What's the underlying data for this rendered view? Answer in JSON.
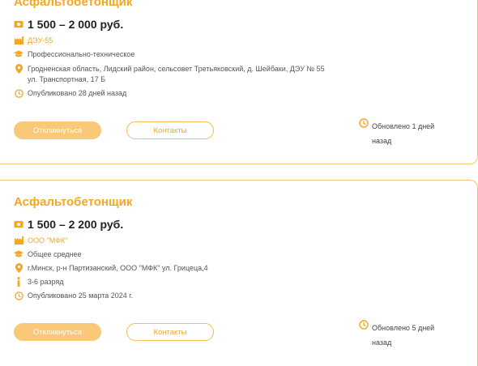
{
  "colors": {
    "accent": "#f5a623",
    "apply_bg": "#f9c879",
    "border": "#f5c37a"
  },
  "vacancies": [
    {
      "title": "Асфальтобетонщик",
      "salary": "1 500 – 2 000 руб.",
      "company": "ДЭУ-55",
      "education": "Профессионально-техническое",
      "address_line1": "Гродненская область, Лидский район, сельсовет Третьяковский, д. Шейбаки, ДЭУ № 55",
      "address_line2": "ул. Транспортная, 17 Б",
      "published": "Опубликовано 28 дней назад",
      "apply_label": "Откликнуться",
      "contacts_label": "Контакты",
      "updated_line1": "Обновлено 1 дней",
      "updated_line2": "назад"
    },
    {
      "title": "Асфальтобетонщик",
      "salary": "1 500 – 2 200 руб.",
      "company": "ООО \"МФК\"",
      "education": "Общее среднее",
      "address_line1": "г.Минск, р-н Партизанский, ООО \"МФК\" ул. Грицеца,4",
      "grade": "3-6 разряд",
      "published": "Опубликовано 25 марта 2024 г.",
      "apply_label": "Откликнуться",
      "contacts_label": "Контакты",
      "updated_line1": "Обновлено 5 дней",
      "updated_line2": "назад"
    }
  ]
}
